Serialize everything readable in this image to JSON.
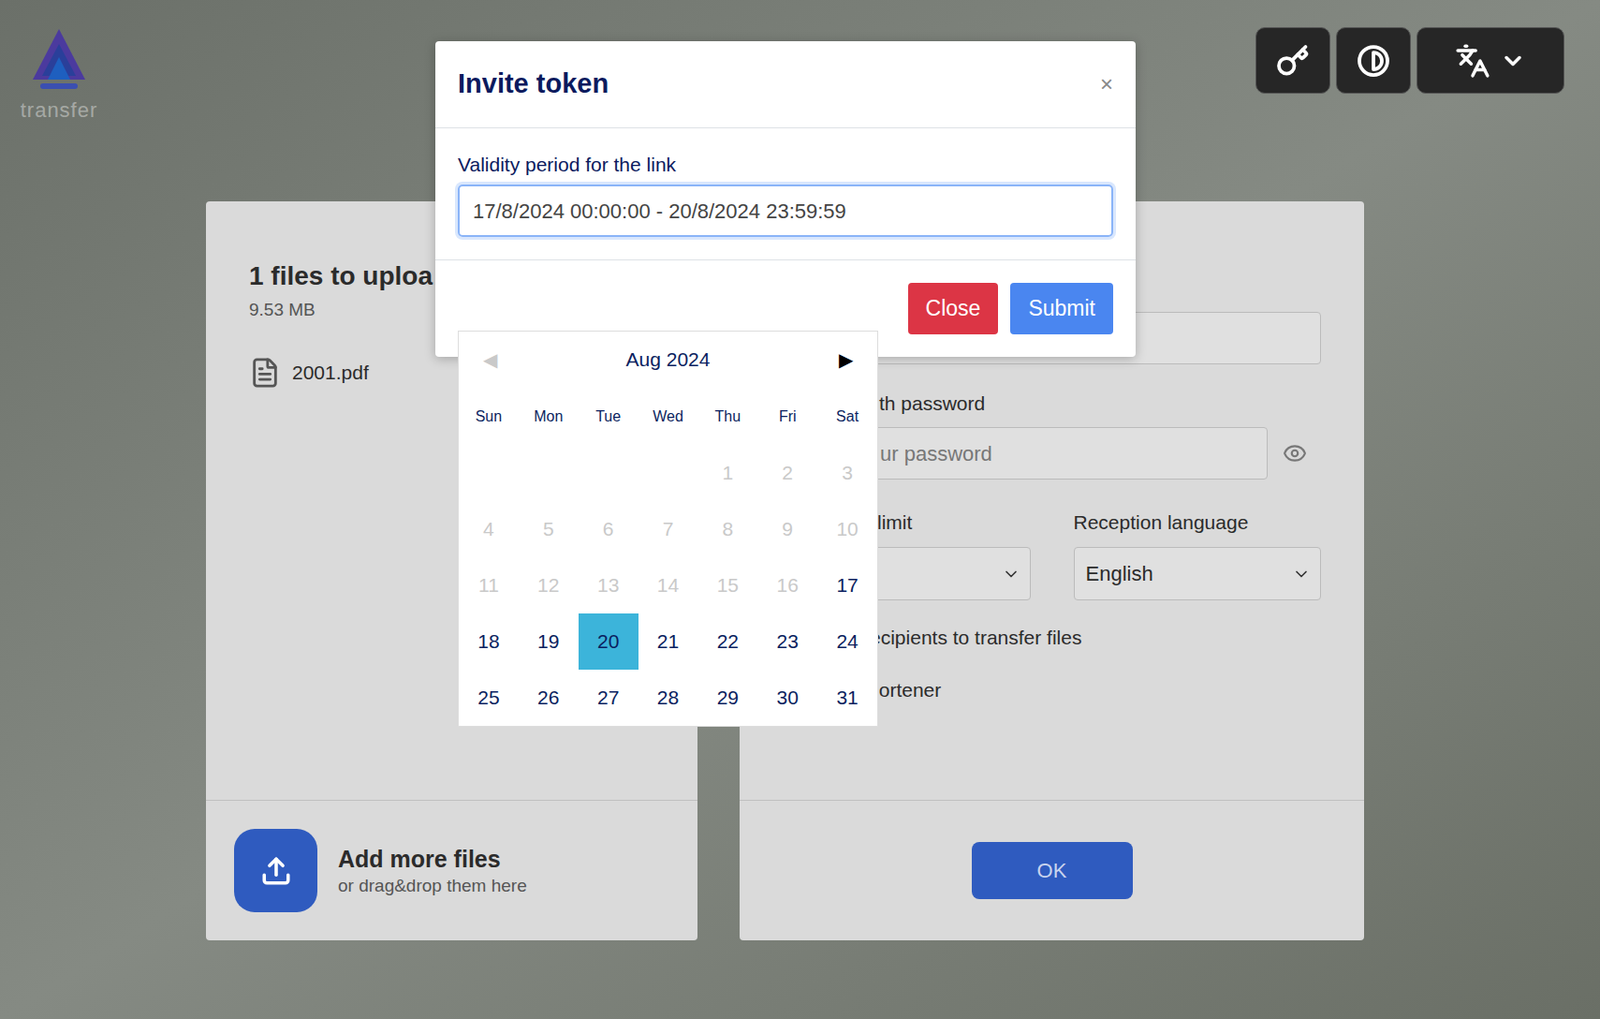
{
  "logo": {
    "text": "transfer"
  },
  "upload_panel": {
    "title": "1 files to uploa",
    "size": "9.53 MB",
    "files": [
      {
        "name": "2001.pdf"
      }
    ],
    "add_button": {
      "title": "Add more files",
      "subtitle": "or drag&drop them here"
    }
  },
  "options_panel": {
    "password_label": "th password",
    "password_placeholder": "ur password",
    "limit_label": "limit",
    "language_label": "Reception language",
    "language_value": "English",
    "checkboxes": [
      {
        "label": "Allow recipients to transfer files",
        "checked": false
      },
      {
        "label": "URL Shortener",
        "checked": false
      }
    ],
    "ok_button": "OK"
  },
  "dialog": {
    "title": "Invite token",
    "close_icon": "×",
    "field_label": "Validity period for the link",
    "field_value": "17/8/2024 00:00:00 - 20/8/2024 23:59:59",
    "buttons": [
      {
        "label": "Close",
        "color": "#dc3545"
      },
      {
        "label": "Submit",
        "color": "#4a86f0"
      }
    ]
  },
  "calendar": {
    "month": "Aug 2024",
    "prev": "◀",
    "next": "▶",
    "prev_disabled": true,
    "weekdays": [
      "Sun",
      "Mon",
      "Tue",
      "Wed",
      "Thu",
      "Fri",
      "Sat"
    ],
    "weeks": [
      [
        null,
        null,
        null,
        null,
        {
          "label": "1",
          "disabled": true,
          "selected": false
        },
        {
          "label": "2",
          "disabled": true,
          "selected": false
        },
        {
          "label": "3",
          "disabled": true,
          "selected": false
        }
      ],
      [
        {
          "label": "4",
          "disabled": true,
          "selected": false
        },
        {
          "label": "5",
          "disabled": true,
          "selected": false
        },
        {
          "label": "6",
          "disabled": true,
          "selected": false
        },
        {
          "label": "7",
          "disabled": true,
          "selected": false
        },
        {
          "label": "8",
          "disabled": true,
          "selected": false
        },
        {
          "label": "9",
          "disabled": true,
          "selected": false
        },
        {
          "label": "10",
          "disabled": true,
          "selected": false
        }
      ],
      [
        {
          "label": "11",
          "disabled": true,
          "selected": false
        },
        {
          "label": "12",
          "disabled": true,
          "selected": false
        },
        {
          "label": "13",
          "disabled": true,
          "selected": false
        },
        {
          "label": "14",
          "disabled": true,
          "selected": false
        },
        {
          "label": "15",
          "disabled": true,
          "selected": false
        },
        {
          "label": "16",
          "disabled": true,
          "selected": false
        },
        {
          "label": "17",
          "disabled": false,
          "selected": false
        }
      ],
      [
        {
          "label": "18",
          "disabled": false,
          "selected": false
        },
        {
          "label": "19",
          "disabled": false,
          "selected": false
        },
        {
          "label": "20",
          "disabled": false,
          "selected": true
        },
        {
          "label": "21",
          "disabled": false,
          "selected": false
        },
        {
          "label": "22",
          "disabled": false,
          "selected": false
        },
        {
          "label": "23",
          "disabled": false,
          "selected": false
        },
        {
          "label": "24",
          "disabled": false,
          "selected": false
        }
      ],
      [
        {
          "label": "25",
          "disabled": false,
          "selected": false
        },
        {
          "label": "26",
          "disabled": false,
          "selected": false
        },
        {
          "label": "27",
          "disabled": false,
          "selected": false
        },
        {
          "label": "28",
          "disabled": false,
          "selected": false
        },
        {
          "label": "29",
          "disabled": false,
          "selected": false
        },
        {
          "label": "30",
          "disabled": false,
          "selected": false
        },
        {
          "label": "31",
          "disabled": false,
          "selected": false
        }
      ]
    ]
  }
}
